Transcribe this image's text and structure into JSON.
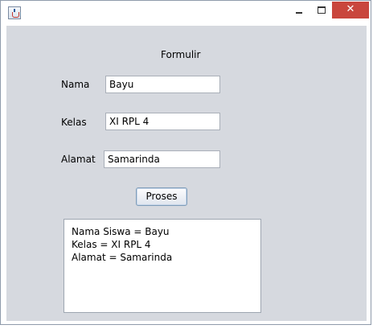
{
  "window": {
    "title": "",
    "controls": {
      "minimize_icon": "minimize-icon",
      "maximize_icon": "maximize-icon",
      "close_icon": "close-icon",
      "close_color": "#c9463d"
    },
    "app_icon": "java-cup-icon"
  },
  "form": {
    "title": "Formulir",
    "fields": [
      {
        "label": "Nama",
        "value": "Bayu"
      },
      {
        "label": "Kelas",
        "value": "XI RPL 4"
      },
      {
        "label": "Alamat",
        "value": "Samarinda"
      }
    ],
    "button_label": "Proses",
    "output_lines": [
      "Nama Siswa = Bayu",
      "Kelas = XI RPL 4",
      "Alamat = Samarinda"
    ]
  },
  "colors": {
    "panel": "#d6d9df",
    "close_button": "#c9463d"
  }
}
